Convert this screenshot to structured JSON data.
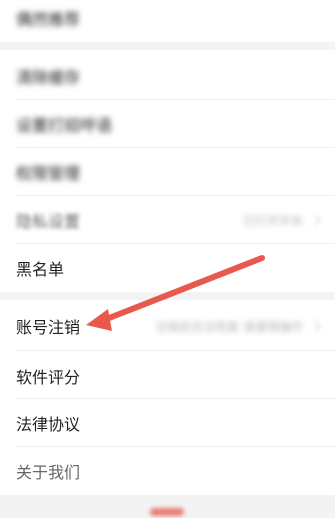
{
  "settings": {
    "rows": [
      {
        "label": "偶然推荐",
        "value": ""
      },
      {
        "label": "清除缓存",
        "value": ""
      },
      {
        "label": "设置打招呼语",
        "value": ""
      },
      {
        "label": "权限管理",
        "value": ""
      },
      {
        "label": "隐私设置",
        "value": "已打开开关"
      },
      {
        "label": "黑名单",
        "value": ""
      },
      {
        "label": "账号注销",
        "value": "注销后无法恢复 请谨慎操作"
      },
      {
        "label": "软件评分",
        "value": ""
      },
      {
        "label": "法律协议",
        "value": ""
      },
      {
        "label": "关于我们",
        "value": ""
      }
    ]
  },
  "annotation": {
    "arrow_color": "#e8594d"
  }
}
